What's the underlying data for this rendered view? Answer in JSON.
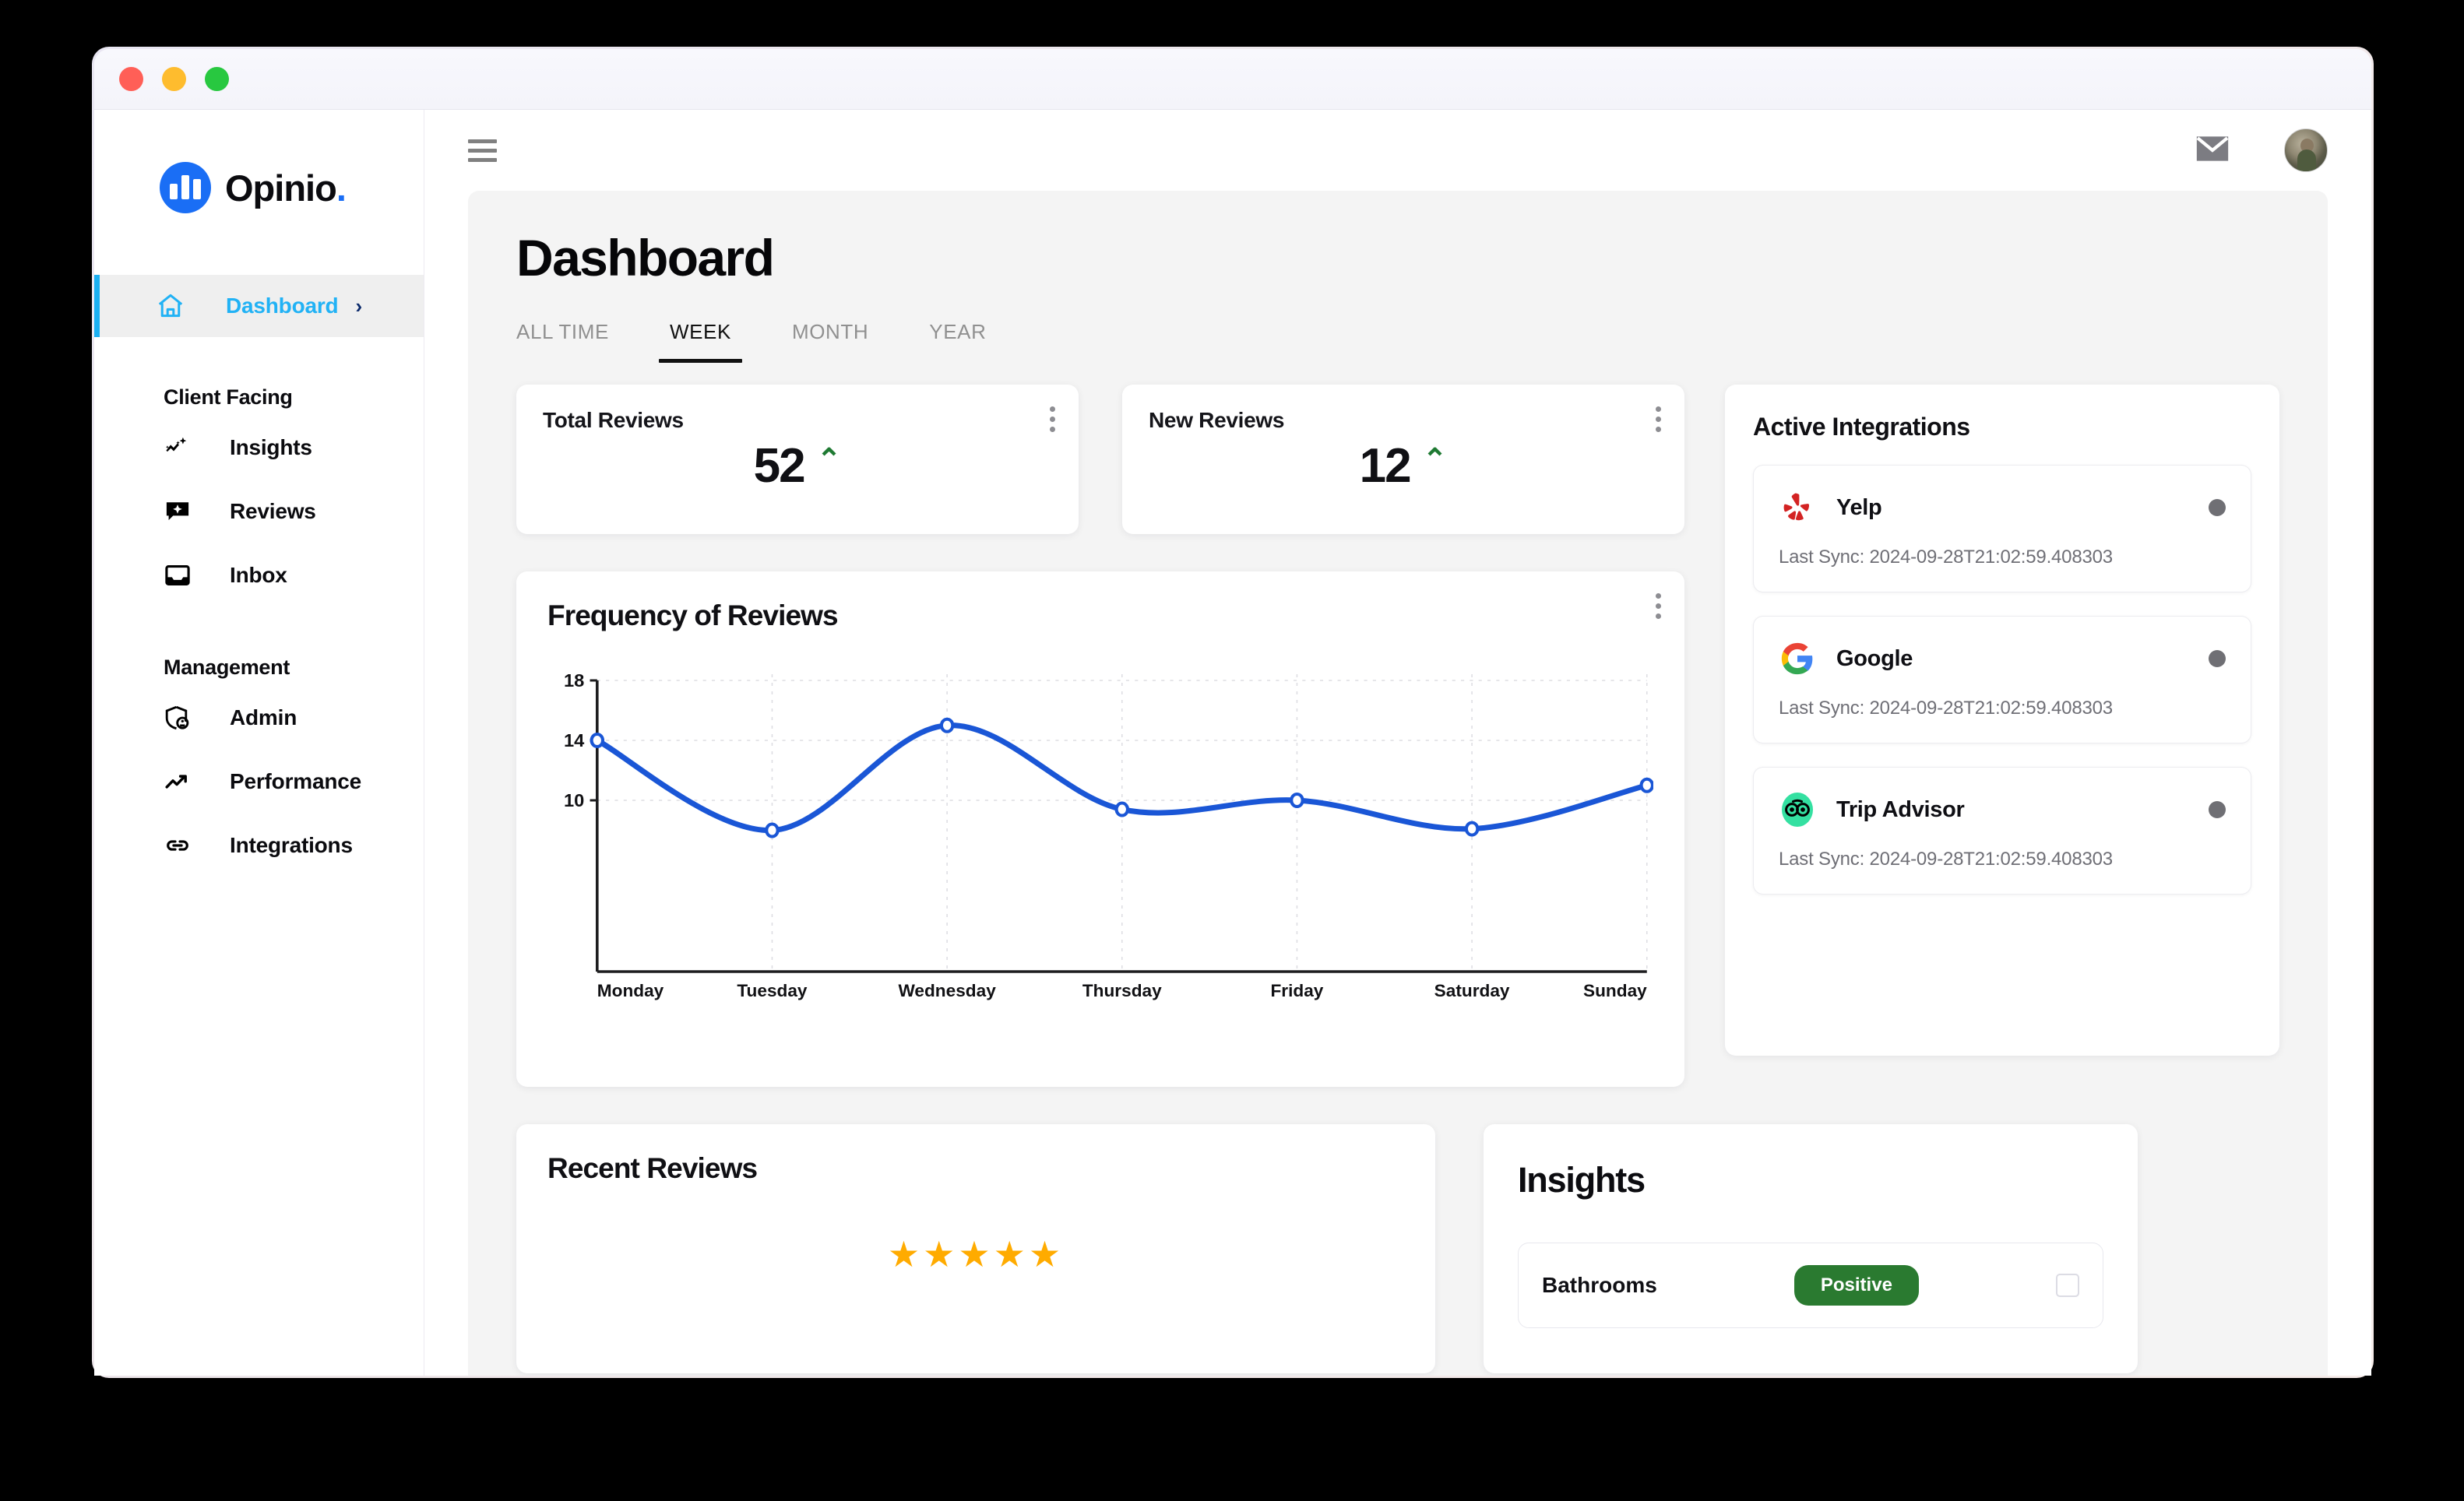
{
  "window": {
    "traffic_lights": [
      "close",
      "minimize",
      "maximize"
    ]
  },
  "brand": {
    "name": "Opinio",
    "dot": "."
  },
  "sidebar": {
    "active": {
      "label": "Dashboard",
      "icon": "home-icon",
      "chevron": "›"
    },
    "groups": [
      {
        "title": "Client Facing",
        "items": [
          {
            "label": "Insights",
            "icon": "sparkle-chart-icon"
          },
          {
            "label": "Reviews",
            "icon": "comment-sparkle-icon"
          },
          {
            "label": "Inbox",
            "icon": "inbox-icon"
          }
        ]
      },
      {
        "title": "Management",
        "items": [
          {
            "label": "Admin",
            "icon": "shield-user-icon"
          },
          {
            "label": "Performance",
            "icon": "trending-up-icon"
          },
          {
            "label": "Integrations",
            "icon": "link-icon"
          }
        ]
      }
    ]
  },
  "topbar": {
    "menu_icon": "hamburger-icon",
    "mail_icon": "mail-icon",
    "avatar": "user-avatar"
  },
  "page": {
    "title": "Dashboard"
  },
  "tabs": [
    {
      "label": "ALL TIME",
      "active": false
    },
    {
      "label": "WEEK",
      "active": true
    },
    {
      "label": "MONTH",
      "active": false
    },
    {
      "label": "YEAR",
      "active": false
    }
  ],
  "stats": [
    {
      "title": "Total Reviews",
      "value": "52",
      "trend": "⌃",
      "trend_color": "#1f7a33"
    },
    {
      "title": "New Reviews",
      "value": "12",
      "trend": "⌃",
      "trend_color": "#1f7a33"
    }
  ],
  "chart_card": {
    "title": "Frequency of Reviews",
    "menu_icon": "kebab-menu-icon"
  },
  "chart_data": {
    "type": "line",
    "title": "Frequency of Reviews",
    "xlabel": "",
    "ylabel": "",
    "categories": [
      "Monday",
      "Tuesday",
      "Wednesday",
      "Thursday",
      "Friday",
      "Saturday",
      "Sunday"
    ],
    "values": [
      14,
      8,
      15,
      9.4,
      10,
      8.1,
      11
    ],
    "yticks": [
      10,
      14,
      18
    ],
    "ylim": [
      0,
      18
    ],
    "grid": true,
    "legend": "none",
    "line_color": "#1a56d6",
    "marker": "open-circle",
    "smoothing": "spline"
  },
  "integrations": {
    "title": "Active Integrations",
    "items": [
      {
        "name": "Yelp",
        "logo": "yelp-logo",
        "sync_label": "Last Sync: 2024-09-28T21:02:59.408303",
        "status": "inactive"
      },
      {
        "name": "Google",
        "logo": "google-logo",
        "sync_label": "Last Sync: 2024-09-28T21:02:59.408303",
        "status": "inactive"
      },
      {
        "name": "Trip Advisor",
        "logo": "tripadvisor-logo",
        "sync_label": "Last Sync: 2024-09-28T21:02:59.408303",
        "status": "inactive"
      }
    ]
  },
  "recent_reviews": {
    "title": "Recent Reviews",
    "stars": "★★★★★",
    "star_count": 5,
    "star_color": "#ffab00"
  },
  "insights_panel": {
    "title": "Insights",
    "row": {
      "label": "Bathrooms",
      "badge": "Positive",
      "badge_color": "#2a7a30"
    }
  }
}
